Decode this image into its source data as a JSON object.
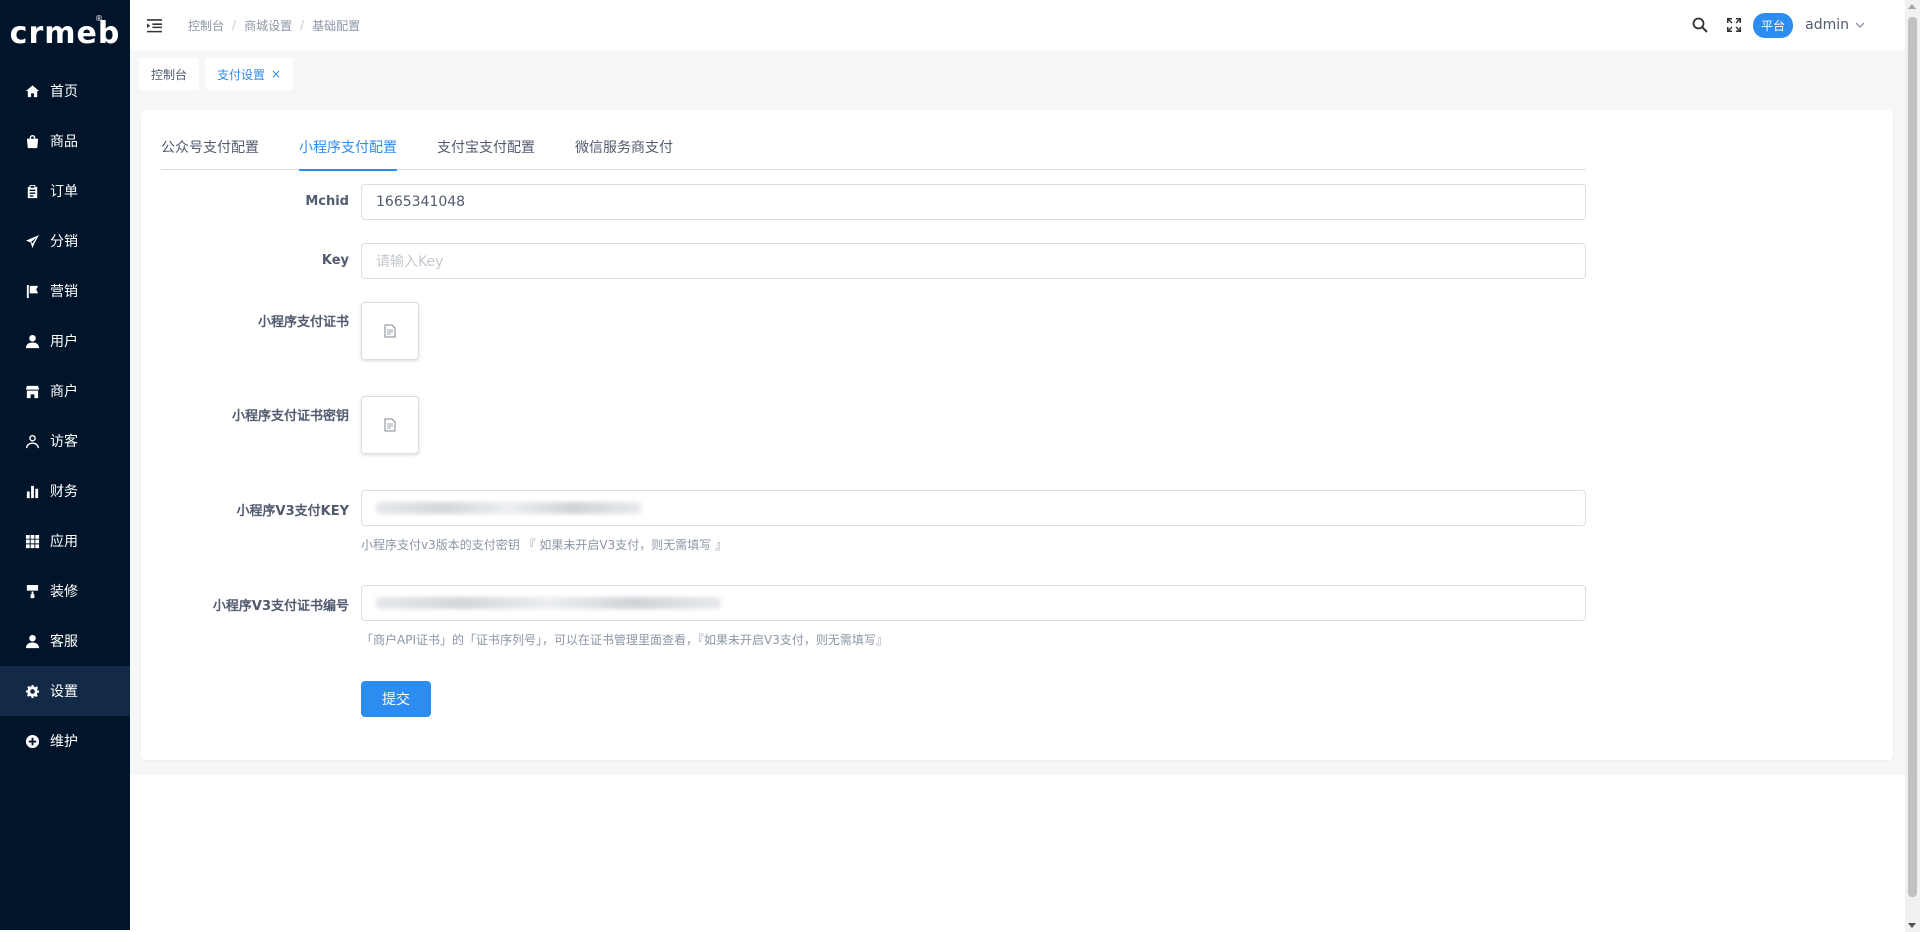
{
  "app": {
    "logo_text": "crmeb",
    "logo_mark": "®"
  },
  "sidebar": {
    "items": [
      {
        "label": "首页",
        "icon": "home-icon"
      },
      {
        "label": "商品",
        "icon": "bag-icon"
      },
      {
        "label": "订单",
        "icon": "clipboard-icon"
      },
      {
        "label": "分销",
        "icon": "send-icon"
      },
      {
        "label": "营销",
        "icon": "flag-icon"
      },
      {
        "label": "用户",
        "icon": "user-icon"
      },
      {
        "label": "商户",
        "icon": "store-icon"
      },
      {
        "label": "访客",
        "icon": "visitor-icon"
      },
      {
        "label": "财务",
        "icon": "chart-icon"
      },
      {
        "label": "应用",
        "icon": "grid-icon"
      },
      {
        "label": "装修",
        "icon": "brush-icon"
      },
      {
        "label": "客服",
        "icon": "service-icon"
      },
      {
        "label": "设置",
        "icon": "gear-icon"
      },
      {
        "label": "维护",
        "icon": "maintain-icon"
      }
    ],
    "active_index": 12
  },
  "header": {
    "breadcrumb": [
      "控制台",
      "商城设置",
      "基础配置"
    ],
    "breadcrumb_sep": "/",
    "platform_badge": "平台",
    "user_name": "admin"
  },
  "tagsbar": {
    "tags": [
      {
        "label": "控制台",
        "active": false
      },
      {
        "label": "支付设置",
        "active": true,
        "close": "×"
      }
    ]
  },
  "tabs": [
    {
      "label": "公众号支付配置",
      "active": false
    },
    {
      "label": "小程序支付配置",
      "active": true
    },
    {
      "label": "支付宝支付配置",
      "active": false
    },
    {
      "label": "微信服务商支付",
      "active": false
    }
  ],
  "form": {
    "mchid": {
      "label": "Mchid",
      "value": "1665341048"
    },
    "key": {
      "label": "Key",
      "placeholder": "请输入Key"
    },
    "cert": {
      "label": "小程序支付证书"
    },
    "cert_key": {
      "label": "小程序支付证书密钥"
    },
    "v3_key": {
      "label": "小程序V3支付KEY",
      "hint": "小程序支付v3版本的支付密钥 『 如果未开启V3支付，则无需填写 』"
    },
    "v3_serial": {
      "label": "小程序V3支付证书编号",
      "hint": "「商户API证书」的「证书序列号」，可以在证书管理里面查看，『如果未开启V3支付，则无需填写』"
    },
    "submit_label": "提交"
  },
  "colors": {
    "sidebar_bg": "#001529",
    "sidebar_active": "#132a47",
    "primary": "#2d8cf0",
    "page_bg": "#f5f7f9"
  }
}
